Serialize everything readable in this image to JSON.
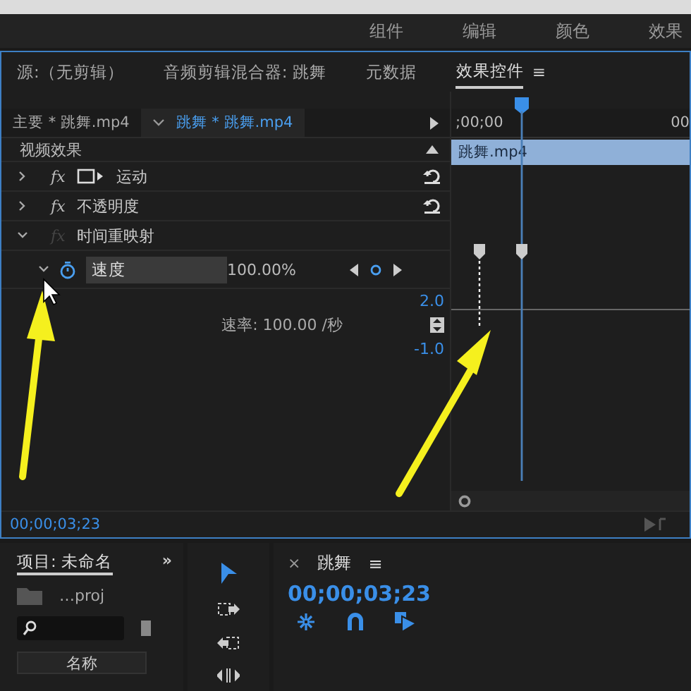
{
  "workspaces": [
    {
      "label": "组件",
      "selected": false
    },
    {
      "label": "编辑",
      "selected": false
    },
    {
      "label": "颜色",
      "selected": false
    },
    {
      "label": "效果",
      "selected": false
    }
  ],
  "panel_tabs": [
    {
      "label": "源:（无剪辑）",
      "selected": false
    },
    {
      "label": "音频剪辑混合器: 跳舞",
      "selected": false
    },
    {
      "label": "元数据",
      "selected": false
    },
    {
      "label": "效果控件",
      "selected": true
    }
  ],
  "panel_menu": "≡",
  "clip_tabs": [
    {
      "label": "主要 * 跳舞.mp4",
      "selected": false
    },
    {
      "label": "跳舞 * 跳舞.mp4",
      "selected": true
    }
  ],
  "ruler": {
    "start": ";00;00",
    "end": "00"
  },
  "section": "视频效果",
  "effects": [
    {
      "name": "运动",
      "badge": "fx",
      "kind": "motion",
      "expanded": false,
      "disabled": false,
      "reset": true
    },
    {
      "name": "不透明度",
      "badge": "fx",
      "kind": "effect",
      "expanded": false,
      "disabled": false,
      "reset": true
    },
    {
      "name": "时间重映射",
      "badge": "fx",
      "kind": "effect",
      "expanded": true,
      "disabled": true,
      "reset": false
    }
  ],
  "speed": {
    "label": "速度",
    "value": "100.00%",
    "max": "2.0",
    "rate": "速率: 100.00 /秒",
    "min": "-1.0"
  },
  "clip_name": "跳舞.mp4",
  "timecode": "00;00;03;23",
  "project": {
    "title": "项目: 未命名",
    "more": "»",
    "file": "…proj",
    "column": "名称"
  },
  "timeline": {
    "close": "×",
    "title": "跳舞",
    "menu": "≡",
    "timecode": "00;00;03;23"
  }
}
